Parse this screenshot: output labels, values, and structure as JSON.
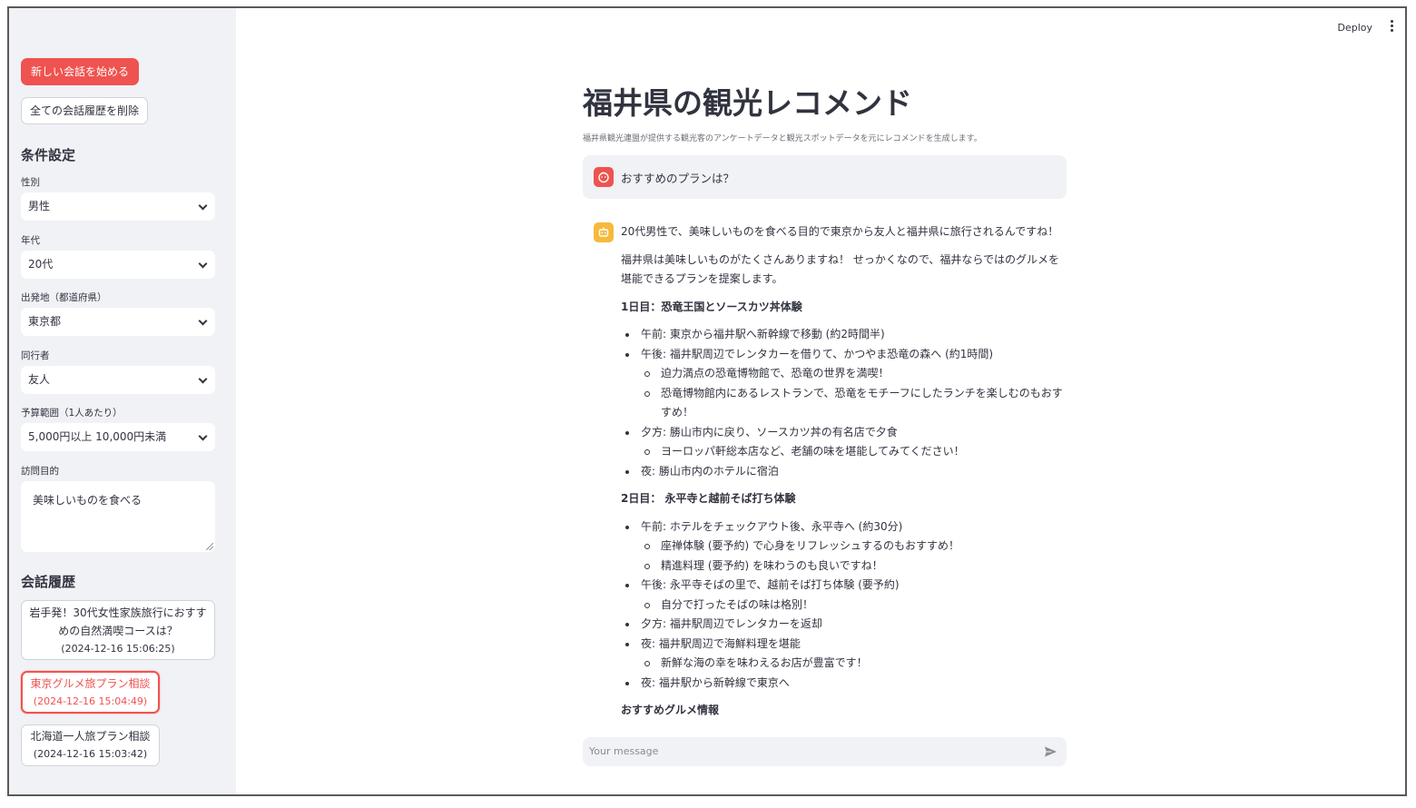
{
  "header": {
    "deploy_label": "Deploy",
    "menu_icon": "kebab-menu-icon"
  },
  "sidebar": {
    "new_chat_label": "新しい会話を始める",
    "delete_all_label": "全ての会話履歴を削除",
    "settings_heading": "条件設定",
    "fields": [
      {
        "label": "性別",
        "value": "男性"
      },
      {
        "label": "年代",
        "value": "20代"
      },
      {
        "label": "出発地（都道府県）",
        "value": "東京都"
      },
      {
        "label": "同行者",
        "value": "友人"
      },
      {
        "label": "予算範囲（1人あたり）",
        "value": "5,000円以上 10,000円未満"
      }
    ],
    "purpose_label": "訪問目的",
    "purpose_value": "美味しいものを食べる",
    "history_heading": "会話履歴",
    "history": [
      {
        "title": "岩手発！30代女性家族旅行におすすめの自然満喫コースは？",
        "title_l1": "岩手発！30代女性家族旅行におすす",
        "title_l2": "めの自然満喫コースは？",
        "time": "(2024-12-16 15:06:25)"
      },
      {
        "title": "東京グルメ旅プラン相談",
        "time": "(2024-12-16 15:04:49)"
      },
      {
        "title": "北海道一人旅プラン相談",
        "time": "(2024-12-16 15:03:42)"
      }
    ]
  },
  "main": {
    "title": "福井県の観光レコメンド",
    "caption": "福井県観光連盟が提供する観光客のアンケートデータと観光スポットデータを元にレコメンドを生成します。",
    "user_message": "おすすめのプランは？",
    "bot": {
      "p1": "20代男性で、美味しいものを食べる目的で東京から友人と福井県に旅行されるんですね！",
      "p2": "福井県は美味しいものがたくさんありますね！ せっかくなので、福井ならではのグルメを堪能できるプランを提案します。",
      "day1_title": "1日目：恐竜王国とソースカツ丼体験",
      "day1_items": [
        "午前: 東京から福井駅へ新幹線で移動 (約2時間半)",
        "午後: 福井駅周辺でレンタカーを借りて、かつやま恐竜の森へ (約1時間)",
        "迫力満点の恐竜博物館で、恐竜の世界を満喫！",
        "恐竜博物館内にあるレストランで、恐竜をモチーフにしたランチを楽しむのもおすすめ！",
        "夕方: 勝山市内に戻り、ソースカツ丼の有名店で夕食",
        "ヨーロッパ軒総本店など、老舗の味を堪能してみてください！",
        "夜: 勝山市内のホテルに宿泊"
      ],
      "day2_title": "2日目： 永平寺と越前そば打ち体験",
      "day2_items": [
        "午前: ホテルをチェックアウト後、永平寺へ (約30分)",
        "座禅体験 (要予約) で心身をリフレッシュするのもおすすめ！",
        "精進料理 (要予約) を味わうのも良いですね！",
        "午後: 永平寺そばの里で、越前そば打ち体験 (要予約)",
        "自分で打ったそばの味は格別！",
        "夕方: 福井駅周辺でレンタカーを返却",
        "夜: 福井駅周辺で海鮮料理を堪能",
        "新鮮な海の幸を味わえるお店が豊富です！",
        "夜: 福井駅から新幹線で東京へ"
      ],
      "gourmet_title": "おすすめグルメ情報"
    },
    "input_placeholder": "Your message"
  },
  "colors": {
    "primary": "#ef5350",
    "sidebar_bg": "#f0f2f6",
    "bot_avatar": "#f6b93b",
    "text": "#31333f"
  }
}
